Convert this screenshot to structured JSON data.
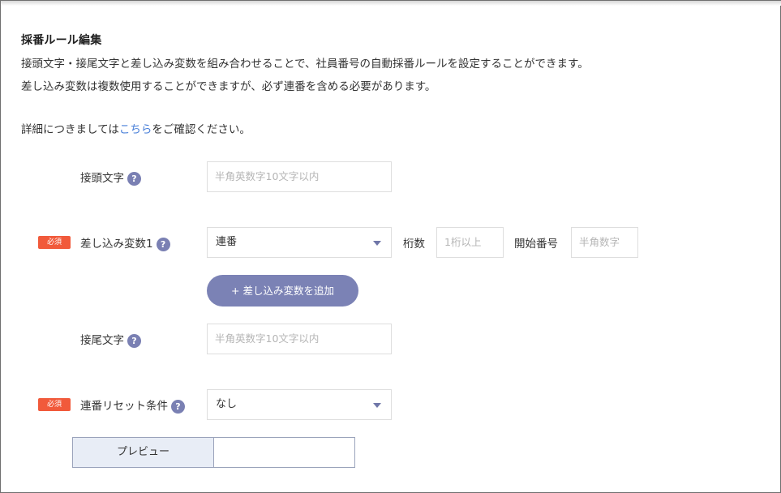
{
  "section": {
    "title": "採番ルール編集",
    "desc_line1": "接頭文字・接尾文字と差し込み変数を組み合わせることで、社員番号の自動採番ルールを設定することができます。",
    "desc_line2": "差し込み変数は複数使用することができますが、必ず連番を含める必要があります。",
    "detail_prefix": "詳細につきましては",
    "detail_link": "こちら",
    "detail_suffix": "をご確認ください。"
  },
  "fields": {
    "prefix": {
      "label": "接頭文字",
      "placeholder": "半角英数字10文字以内"
    },
    "variable1": {
      "required_badge": "必須",
      "label": "差し込み変数1",
      "selected": "連番",
      "digits_label": "桁数",
      "digits_placeholder": "1桁以上",
      "start_label": "開始番号",
      "start_placeholder": "半角数字"
    },
    "add_variable_button": "+ 差し込み変数を追加",
    "suffix": {
      "label": "接尾文字",
      "placeholder": "半角英数字10文字以内"
    },
    "reset": {
      "required_badge": "必須",
      "label": "連番リセット条件",
      "selected": "なし"
    }
  },
  "preview": {
    "label": "プレビュー",
    "value": ""
  },
  "icons": {
    "help": "question-mark-icon",
    "dropdown": "caret-down-icon"
  },
  "colors": {
    "accent": "#7b82b5",
    "required": "#f15a3b",
    "link": "#4a80d9"
  }
}
